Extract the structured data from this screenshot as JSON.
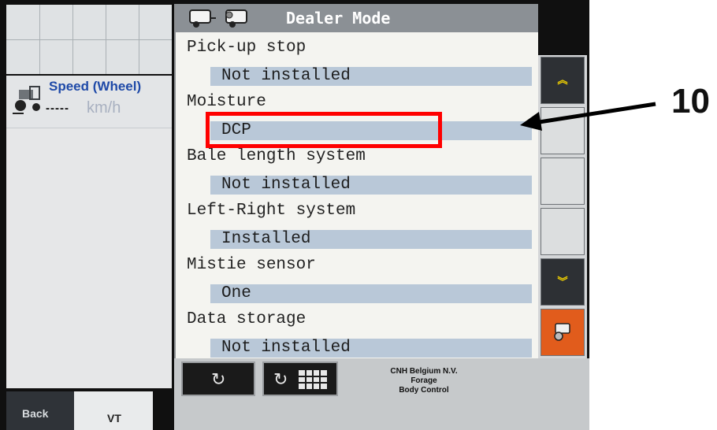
{
  "header": {
    "title": "Dealer Mode",
    "icons": [
      "baler-icon",
      "baler-settings-icon"
    ]
  },
  "speed": {
    "label": "Speed (Wheel)",
    "value": "-----",
    "unit": "km/h"
  },
  "settings": [
    {
      "label": "Pick-up stop",
      "value": "Not installed"
    },
    {
      "label": "Moisture",
      "value": "DCP"
    },
    {
      "label": "Bale length system",
      "value": "Not installed"
    },
    {
      "label": "Left-Right system",
      "value": "Installed"
    },
    {
      "label": "Mistie sensor",
      "value": "One"
    },
    {
      "label": "Data storage",
      "value": "Not installed"
    }
  ],
  "footer": {
    "brand_line1": "CNH Belgium N.V.",
    "brand_line2": "Forage",
    "brand_line3": "Body Control"
  },
  "tabs": {
    "back": "Back",
    "vt": "VT"
  },
  "softkeys": {
    "up": "«",
    "down": "»"
  },
  "annotation": {
    "callout": "10",
    "highlight_color": "#ff0000"
  },
  "colors": {
    "header": "#8b9095",
    "value_bg": "#b9c8d8",
    "accent": "#e15c1c"
  }
}
